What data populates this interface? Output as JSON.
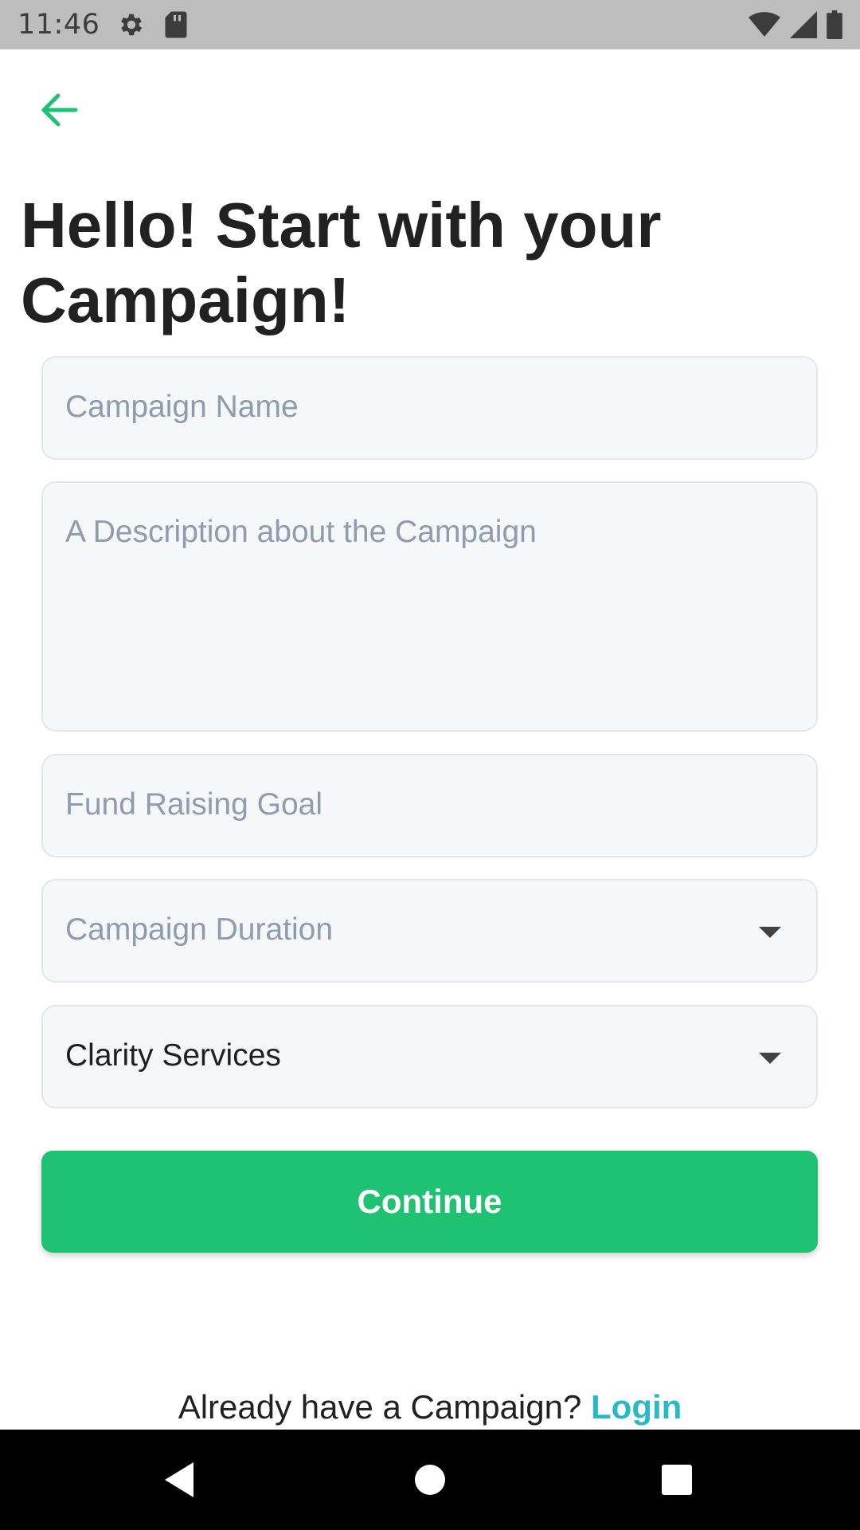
{
  "status_bar": {
    "time": "11:46",
    "icons": [
      "gear-icon",
      "sd-card-icon",
      "wifi-icon",
      "signal-icon",
      "battery-icon"
    ]
  },
  "header": {
    "back_icon": "arrow-left-icon",
    "title_line1": "Hello! Start with your",
    "title_line2": "Campaign!"
  },
  "form": {
    "campaign_name": {
      "placeholder": "Campaign Name",
      "value": ""
    },
    "description": {
      "placeholder": "A Description about the Campaign",
      "value": ""
    },
    "fund_goal": {
      "placeholder": "Fund Raising Goal",
      "value": ""
    },
    "duration": {
      "placeholder": "Campaign Duration",
      "value": ""
    },
    "category": {
      "value": "Clarity Services"
    }
  },
  "actions": {
    "continue_label": "Continue"
  },
  "footer": {
    "prompt": "Already have a Campaign?",
    "login_label": "Login"
  },
  "colors": {
    "accent": "#1fc172",
    "link": "#2ab8c4",
    "field_bg": "#f6f7f9",
    "placeholder": "#8f9bb0"
  },
  "nav_bar": {
    "icons": [
      "back-triangle-icon",
      "home-circle-icon",
      "recents-square-icon"
    ]
  }
}
